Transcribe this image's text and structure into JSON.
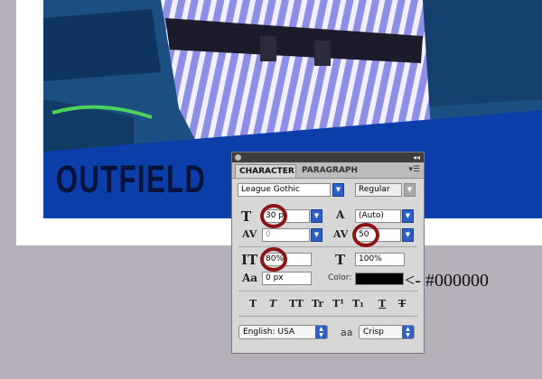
{
  "poster": {
    "headline": "OUTFIELD"
  },
  "panel": {
    "tabs": [
      {
        "label": "CHARACTER",
        "active": true
      },
      {
        "label": "PARAGRAPH",
        "active": false
      }
    ],
    "font_family": "League Gothic",
    "font_style": "Regular",
    "font_size": "30 p",
    "leading": "(Auto)",
    "kerning": "0",
    "tracking": "50",
    "vertical_scale": "80%",
    "horizontal_scale": "100%",
    "baseline_shift": "0 px",
    "color_label": "Color:",
    "color_value": "#000000",
    "language": "English: USA",
    "antialias_icon": "aa",
    "antialias": "Crisp",
    "style_buttons": [
      "T",
      "T",
      "TT",
      "Tr",
      "T¹",
      "T₁",
      "T",
      "T"
    ]
  },
  "annotation": {
    "arrow_text": "<- #000000"
  },
  "colors": {
    "highlight_ring": "#8b1414",
    "poster_band": "#0b3ea8",
    "panel_bg": "#d7d7d7"
  }
}
